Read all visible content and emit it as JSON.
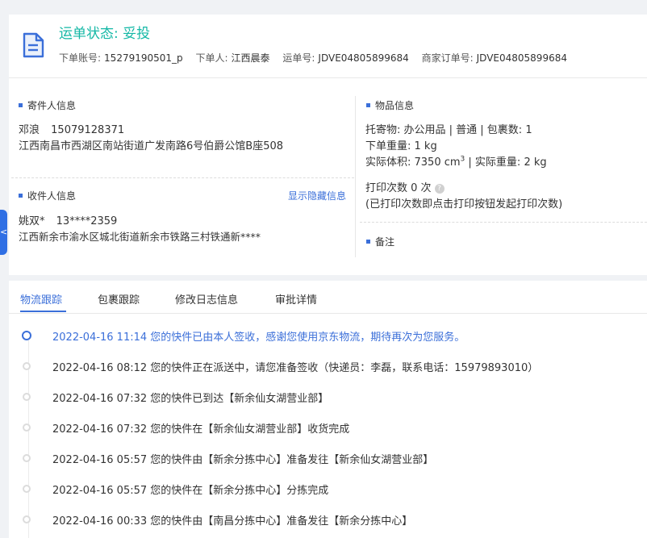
{
  "header": {
    "status_title": "运单状态: 妥投",
    "account_label": "下单账号:",
    "account_value": "15279190501_p",
    "orderer_label": "下单人:",
    "orderer_value": "江西晨泰",
    "waybill_label": "运单号:",
    "waybill_value": "JDVE04805899684",
    "merchant_label": "商家订单号:",
    "merchant_value": "JDVE04805899684"
  },
  "sender": {
    "title": "寄件人信息",
    "name": "邓浪",
    "phone": "15079128371",
    "address": "江西南昌市西湖区南站街道广发南路6号伯爵公馆B座508"
  },
  "receiver": {
    "title": "收件人信息",
    "toggle": "显示隐藏信息",
    "name": "姚双*",
    "phone": "13****2359",
    "address": "江西新余市渝水区城北街道新余市铁路三村铁通新****"
  },
  "goods": {
    "title": "物品信息",
    "line1": "托寄物: 办公用品 | 普通 | 包裹数: 1",
    "line2": "下单重量: 1 kg",
    "line3_prefix": "实际体积: 7350 cm",
    "line3_sup": "3",
    "line3_suffix": " | 实际重量: 2 kg",
    "print_count": "打印次数  0 次",
    "help_icon": "?",
    "print_note": "(已打印次数即点击打印按钮发起打印次数)",
    "remark_title": "备注"
  },
  "side_handle": "<",
  "tabs": [
    "物流跟踪",
    "包裹跟踪",
    "修改日志信息",
    "审批详情"
  ],
  "active_tab": 0,
  "timeline": [
    "2022-04-16 11:14 您的快件已由本人签收，感谢您使用京东物流，期待再次为您服务。",
    "2022-04-16 08:12 您的快件正在派送中，请您准备签收（快递员：李磊，联系电话：15979893010）",
    "2022-04-16 07:32 您的快件已到达【新余仙女湖营业部】",
    "2022-04-16 07:32 您的快件在【新余仙女湖营业部】收货完成",
    "2022-04-16 05:57 您的快件由【新余分拣中心】准备发往【新余仙女湖营业部】",
    "2022-04-16 05:57 您的快件在【新余分拣中心】分拣完成",
    "2022-04-16 00:33 您的快件由【南昌分拣中心】准备发往【新余分拣中心】"
  ],
  "colors": {
    "accent": "#3b6fd9",
    "status": "#14b8a6"
  }
}
